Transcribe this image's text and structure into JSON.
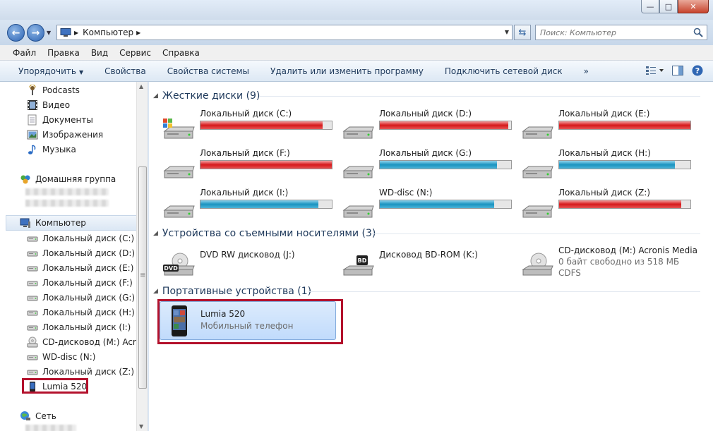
{
  "window": {
    "buttons": {
      "minimize": "—",
      "maximize": "□",
      "close": "✕"
    }
  },
  "nav": {
    "back_icon": "back-arrow-icon",
    "forward_icon": "forward-arrow-icon",
    "address_crumb": "Компьютер",
    "search_placeholder": "Поиск: Компьютер"
  },
  "menu": [
    "Файл",
    "Правка",
    "Вид",
    "Сервис",
    "Справка"
  ],
  "commands": {
    "organize": "Упорядочить",
    "properties": "Свойства",
    "system_properties": "Свойства системы",
    "uninstall": "Удалить или изменить программу",
    "map_drive": "Подключить сетевой диск",
    "more": "»"
  },
  "sidebar": {
    "libraries": [
      "Podcasts",
      "Видео",
      "Документы",
      "Изображения",
      "Музыка"
    ],
    "homegroup": "Домашняя группа",
    "computer": "Компьютер",
    "drives": [
      "Локальный диск (C:)",
      "Локальный диск (D:)",
      "Локальный диск (E:)",
      "Локальный диск (F:)",
      "Локальный диск (G:)",
      "Локальный диск (H:)",
      "Локальный диск (I:)",
      "CD-дисковод (M:) Acron",
      "WD-disc (N:)",
      "Локальный диск (Z:)",
      "Lumia 520"
    ],
    "network": "Сеть"
  },
  "content": {
    "hard_disks_header": "Жесткие диски (9)",
    "hard_disks": [
      {
        "name": "Локальный диск (C:)",
        "fill": 0.93,
        "color": "red"
      },
      {
        "name": "Локальный диск (D:)",
        "fill": 0.98,
        "color": "red"
      },
      {
        "name": "Локальный диск (E:)",
        "fill": 1.0,
        "color": "red"
      },
      {
        "name": "Локальный диск (F:)",
        "fill": 1.0,
        "color": "red"
      },
      {
        "name": "Локальный диск (G:)",
        "fill": 0.89,
        "color": "blue"
      },
      {
        "name": "Локальный диск (H:)",
        "fill": 0.88,
        "color": "blue"
      },
      {
        "name": "Локальный диск (I:)",
        "fill": 0.9,
        "color": "blue"
      },
      {
        "name": "WD-disc (N:)",
        "fill": 0.87,
        "color": "blue"
      },
      {
        "name": "Локальный диск (Z:)",
        "fill": 0.93,
        "color": "red"
      }
    ],
    "removable_header": "Устройства со съемными носителями (3)",
    "removable": [
      {
        "name": "DVD RW дисковод (J:)",
        "label": "DVD"
      },
      {
        "name": "Дисковод BD-ROM (K:)",
        "label": "BD"
      },
      {
        "name": "CD-дисковод (M:) Acronis Media",
        "sub1": "0 байт свободно из 518 МБ",
        "sub2": "CDFS"
      }
    ],
    "portable_header": "Портативные устройства (1)",
    "portable": {
      "name": "Lumia 520",
      "sub": "Мобильный телефон"
    }
  }
}
